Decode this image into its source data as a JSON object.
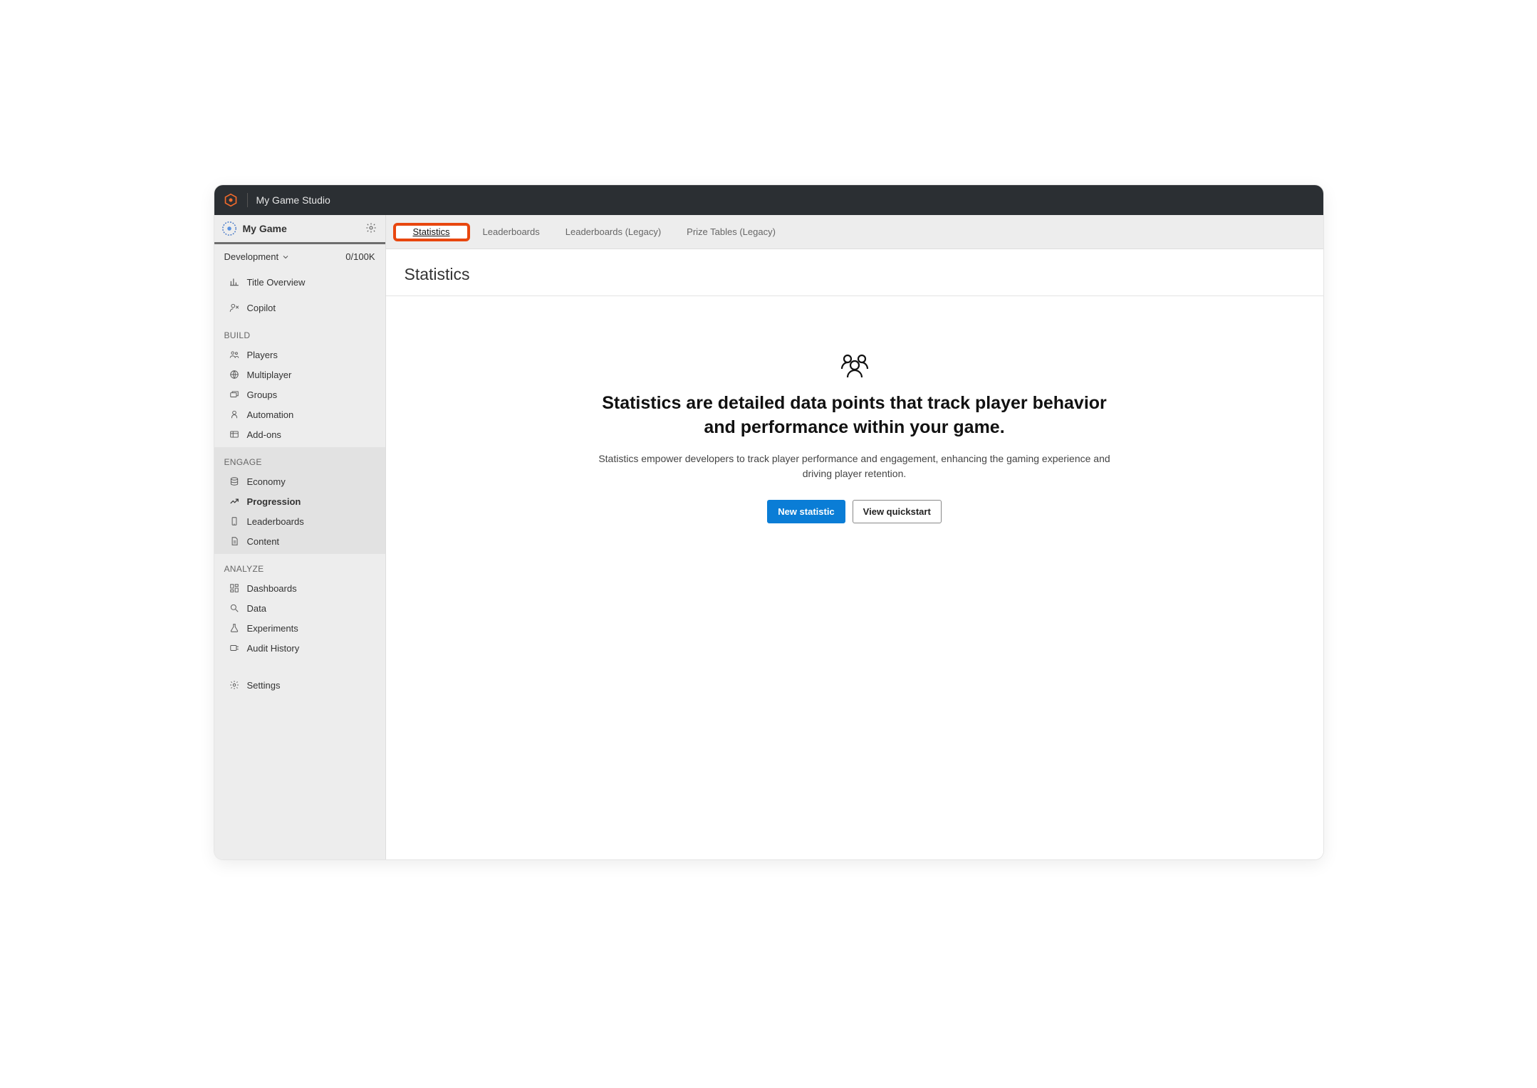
{
  "topbar": {
    "studio_name": "My Game Studio"
  },
  "sidebar": {
    "game_name": "My Game",
    "environment_label": "Development",
    "usage": "0/100K",
    "overview": "Title Overview",
    "copilot": "Copilot",
    "settings": "Settings",
    "sections": {
      "build": {
        "header": "BUILD",
        "items": [
          "Players",
          "Multiplayer",
          "Groups",
          "Automation",
          "Add-ons"
        ]
      },
      "engage": {
        "header": "ENGAGE",
        "items": [
          "Economy",
          "Progression",
          "Leaderboards",
          "Content"
        ],
        "active_index": 1
      },
      "analyze": {
        "header": "ANALYZE",
        "items": [
          "Dashboards",
          "Data",
          "Experiments",
          "Audit History"
        ]
      }
    }
  },
  "tabs": {
    "items": [
      "Statistics",
      "Leaderboards",
      "Leaderboards (Legacy)",
      "Prize Tables (Legacy)"
    ],
    "active_index": 0
  },
  "page": {
    "title": "Statistics",
    "empty_heading": "Statistics are detailed data points that track player behavior and performance within your game.",
    "empty_sub": "Statistics empower developers to track player performance and engagement, enhancing the gaming experience and driving player retention.",
    "primary_button": "New statistic",
    "secondary_button": "View quickstart"
  }
}
